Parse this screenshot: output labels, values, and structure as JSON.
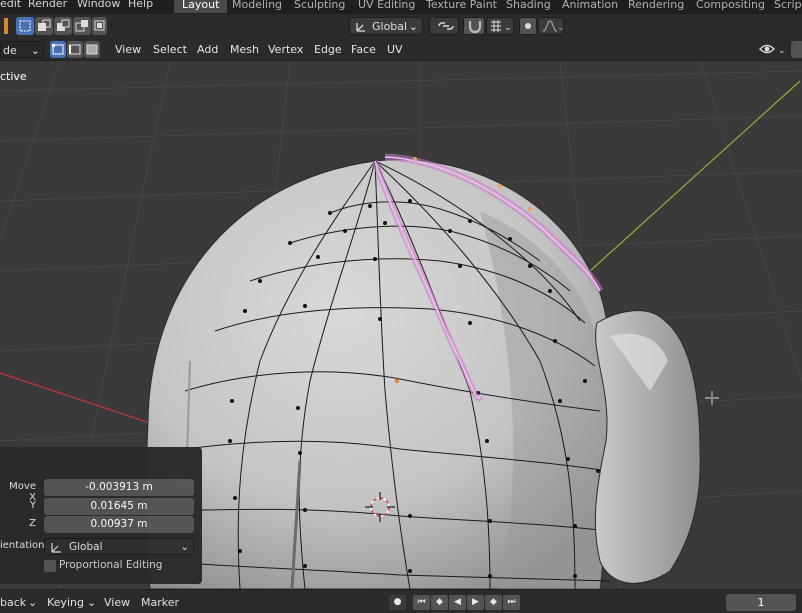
{
  "menubar": {
    "items": [
      "edit",
      "Render",
      "Window",
      "Help"
    ],
    "workspace_tabs": [
      "Layout",
      "Modeling",
      "Sculpting",
      "UV Editing",
      "Texture Paint",
      "Shading",
      "Animation",
      "Rendering",
      "Compositing",
      "Script"
    ],
    "active_tab": "Layout"
  },
  "toolbar": {
    "orientation_label": "Global"
  },
  "header": {
    "mode_label": "de",
    "menus": [
      "View",
      "Select",
      "Add",
      "Mesh",
      "Vertex",
      "Edge",
      "Face",
      "UV"
    ]
  },
  "viewport": {
    "overlay_text": "ctive"
  },
  "operator_panel": {
    "move_x_label": "Move X",
    "move_x_value": "-0.003913 m",
    "y_label": "Y",
    "y_value": "0.01645 m",
    "z_label": "Z",
    "z_value": "0.00937 m",
    "orientation_label": "ientation",
    "orientation_value": "Global",
    "proportional_label": "Proportional Editing"
  },
  "timeline": {
    "playback_label": "back",
    "keying_label": "Keying",
    "view_label": "View",
    "marker_label": "Marker",
    "frame_value": "1"
  },
  "colors": {
    "selection_pink": "#e8a8e8",
    "x_axis": "#c23b3b",
    "y_axis": "#8db33a",
    "accent_blue": "#4772b3"
  }
}
